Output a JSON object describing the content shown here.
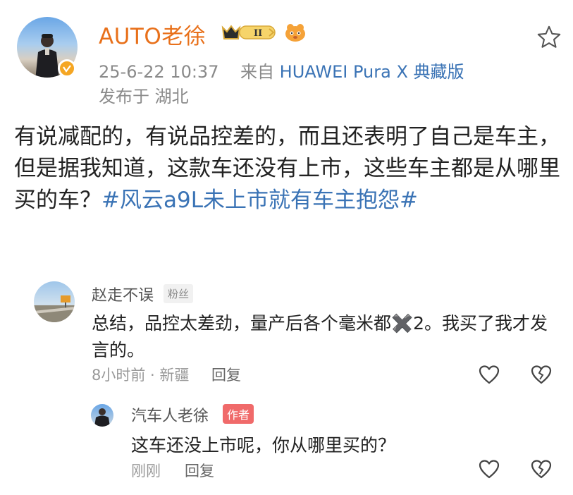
{
  "post": {
    "username": "AUTO老徐",
    "level_badge": "II",
    "time": "25-6-22 10:37",
    "source_prefix": "来自",
    "source_device": "HUAWEI Pura X 典藏版",
    "location": "发布于 湖北",
    "text_main": "有说减配的，有说品控差的，而且还表明了自己是车主，但是据我知道，这款车还没有上市，这些车主都是从哪里买的车？",
    "hashtag": "#风云a9L未上市就有车主抱怨#"
  },
  "comment": {
    "username": "赵走不误",
    "badge": "粉丝",
    "text": "总结，品控太差劲，量产后各个毫米都✖️2。我买了我才发言的。",
    "meta": "8小时前 · 新疆",
    "reply_label": "回复"
  },
  "reply": {
    "username": "汽车人老徐",
    "badge": "作者",
    "text": "这车还没上市呢，你从哪里买的？",
    "meta": "刚刚",
    "reply_label": "回复"
  },
  "colors": {
    "username": "#e8701a",
    "link": "#3a73b5",
    "author_badge": "#f06a6a"
  },
  "icons": [
    "star-icon",
    "verified-icon",
    "crown-badge-icon",
    "pet-icon",
    "heart-icon",
    "broken-heart-icon"
  ]
}
